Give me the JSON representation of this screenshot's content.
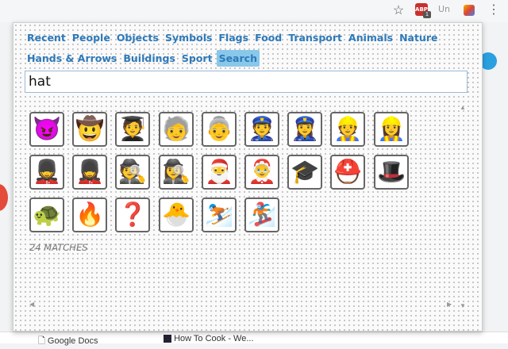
{
  "toolbar": {
    "star_icon": "star-icon",
    "adblock_label": "ABP",
    "adblock_badge": "1",
    "ext2_label": "Un",
    "menu_icon": "menu-dots-icon"
  },
  "popup": {
    "categories_row1": [
      "Recent",
      "People",
      "Objects",
      "Symbols",
      "Flags",
      "Food",
      "Transport",
      "Animals",
      "Nature"
    ],
    "categories_row2": [
      "Hands & Arrows",
      "Buildings",
      "Sport",
      "Search"
    ],
    "active_category": "Search",
    "search_value": "hat",
    "results": [
      {
        "name": "smiling-imp",
        "glyph": "😈"
      },
      {
        "name": "cowboy",
        "glyph": "🤠"
      },
      {
        "name": "student",
        "glyph": "🧑‍🎓"
      },
      {
        "name": "older-person",
        "glyph": "🧓"
      },
      {
        "name": "older-woman",
        "glyph": "👵"
      },
      {
        "name": "police-officer",
        "glyph": "👮"
      },
      {
        "name": "woman-police-officer",
        "glyph": "👮‍♀️"
      },
      {
        "name": "construction-worker",
        "glyph": "👷"
      },
      {
        "name": "woman-construction-worker",
        "glyph": "👷‍♀️"
      },
      {
        "name": "guard",
        "glyph": "💂"
      },
      {
        "name": "woman-guard",
        "glyph": "💂‍♀️"
      },
      {
        "name": "detective",
        "glyph": "🕵️"
      },
      {
        "name": "woman-detective",
        "glyph": "🕵️‍♀️"
      },
      {
        "name": "santa",
        "glyph": "🎅"
      },
      {
        "name": "mrs-claus",
        "glyph": "🤶"
      },
      {
        "name": "graduation-cap",
        "glyph": "🎓"
      },
      {
        "name": "rescue-helmet",
        "glyph": "⛑️"
      },
      {
        "name": "top-hat",
        "glyph": "🎩"
      },
      {
        "name": "bug",
        "glyph": "🐢"
      },
      {
        "name": "fire",
        "glyph": "🔥"
      },
      {
        "name": "question",
        "glyph": "❓"
      },
      {
        "name": "hatching-chick",
        "glyph": "🐣"
      },
      {
        "name": "skier",
        "glyph": "⛷️"
      },
      {
        "name": "snowboarder",
        "glyph": "🏂"
      }
    ],
    "matches_label": "24 MATCHES"
  },
  "bookmarks": [
    "Google Docs",
    "How To Cook - We..."
  ],
  "colors": {
    "accent": "#2e79b9",
    "active_bg": "#89c8ea"
  }
}
